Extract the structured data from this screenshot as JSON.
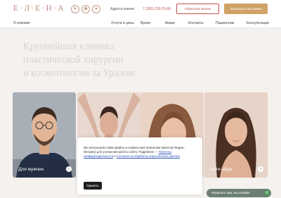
{
  "header": {
    "logo": "Е·Л·Е·Н·А",
    "address_label": "Адреса клиник",
    "phone": "7 (383) 230-15-66",
    "callback_label": "Обратный звонок",
    "appointment_label": "Записаться на прием",
    "social_icons": [
      "telegram-icon",
      "vk-icon",
      "odnoklassniki-icon"
    ]
  },
  "nav": {
    "items": [
      "О клинике",
      "Услуги и цены",
      "Врачи",
      "Акции",
      "Контакты",
      "Пациентам",
      "Консультации"
    ]
  },
  "hero": {
    "headline_lines": [
      "Крупнейшая клиника",
      "пластической хирургии",
      "и косметологии за Уралом"
    ]
  },
  "cards": [
    {
      "label": "Для мужчин"
    },
    {
      "label": ""
    },
    {
      "label": ""
    },
    {
      "label": "Анти-эйдж"
    }
  ],
  "cookie": {
    "text": "Мы используем cookie-файлы и сервисы веб-аналитики (включая Яндекс Метрику) для улучшения работы сайта. Подробнее — ",
    "link1": "Политика конфиденциальности",
    "middle": " и ",
    "link2": "Согласие на обработку персональных данных",
    "end": ".",
    "button_label": "Принять"
  },
  "chat": {
    "text": "Напишите нам, мы онлайн!"
  },
  "colors": {
    "brand_gold": "#d1a267",
    "brand_red": "#c0504a",
    "logo_rose": "#b98a7a",
    "hero_bg": "#f4f1ee",
    "chat_green": "#6d7f74"
  }
}
